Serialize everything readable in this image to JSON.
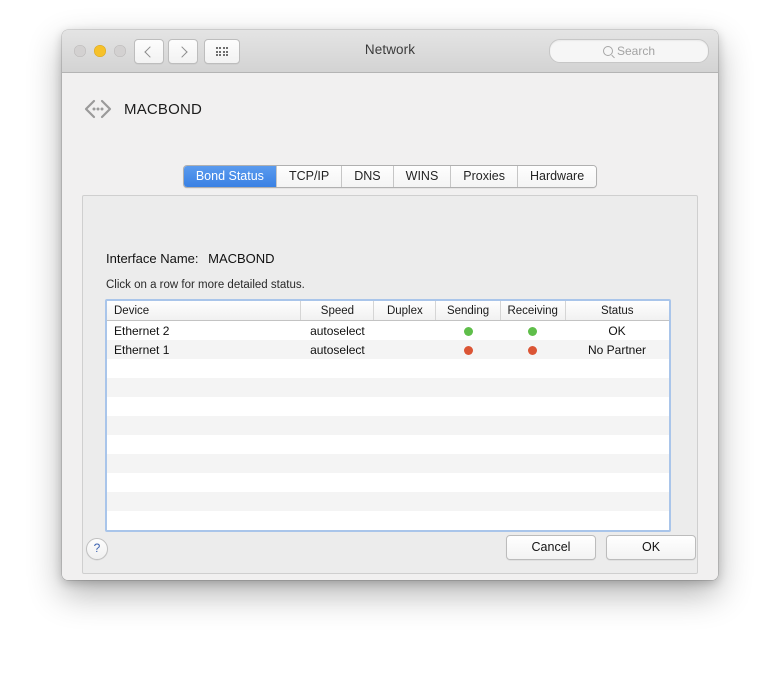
{
  "window": {
    "title": "Network",
    "traffic_lights": [
      "close",
      "minimize",
      "zoom"
    ],
    "nav": {
      "back": "back-chevron",
      "forward": "forward-chevron",
      "show_all": "grid-icon"
    },
    "search": {
      "placeholder": "Search",
      "value": "",
      "icon": "search-icon"
    }
  },
  "header": {
    "icon": "bond-interface-icon",
    "name": "MACBOND"
  },
  "tabs": [
    {
      "label": "Bond Status",
      "active": true
    },
    {
      "label": "TCP/IP",
      "active": false
    },
    {
      "label": "DNS",
      "active": false
    },
    {
      "label": "WINS",
      "active": false
    },
    {
      "label": "Proxies",
      "active": false
    },
    {
      "label": "Hardware",
      "active": false
    }
  ],
  "panel": {
    "interface_label": "Interface Name:",
    "interface_value": "MACBOND",
    "hint": "Click on a row for more detailed status."
  },
  "table": {
    "columns": [
      "Device",
      "Speed",
      "Duplex",
      "Sending",
      "Receiving",
      "Status"
    ],
    "rows": [
      {
        "device": "Ethernet 2",
        "speed": "autoselect",
        "duplex": "",
        "sending": "green",
        "receiving": "green",
        "status": "OK"
      },
      {
        "device": "Ethernet 1",
        "speed": "autoselect",
        "duplex": "",
        "sending": "red",
        "receiving": "red",
        "status": "No Partner"
      }
    ],
    "empty_row_count": 10
  },
  "footer": {
    "help_label": "?",
    "cancel_label": "Cancel",
    "ok_label": "OK"
  },
  "colors": {
    "accent": "#3a81e4",
    "status_ok": "#5fbe4a",
    "status_error": "#db5535",
    "focus_ring": "#a9c5ea"
  }
}
